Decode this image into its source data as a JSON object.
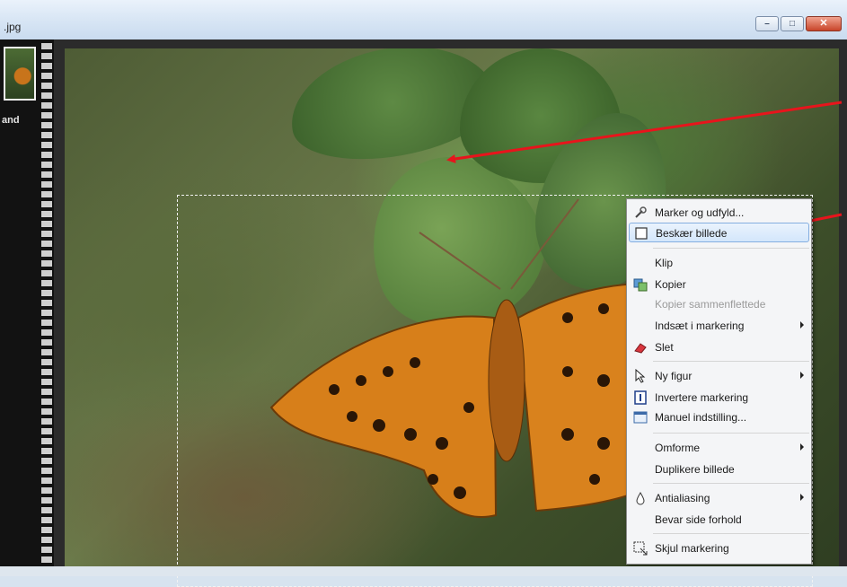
{
  "window": {
    "title": ".jpg",
    "buttons": {
      "minimize_glyph": "–",
      "maximize_glyph": "□",
      "close_glyph": "✕"
    }
  },
  "filmstrip": {
    "thumbnail_label": "and"
  },
  "context_menu": {
    "items": [
      {
        "label": "Marker og udfyld...",
        "icon": "magic-wand-icon"
      },
      {
        "label": "Beskær billede",
        "icon": "crop-icon",
        "highlighted": true
      },
      {
        "label": "Klip"
      },
      {
        "label": "Kopier",
        "icon": "copy-icon"
      },
      {
        "label": "Kopier sammenflettede",
        "disabled": true
      },
      {
        "label": "Indsæt i markering",
        "submenu": true
      },
      {
        "label": "Slet",
        "icon": "eraser-icon"
      },
      {
        "label": "Ny figur",
        "icon": "pointer-icon",
        "submenu": true
      },
      {
        "label": "Invertere markering",
        "icon": "invert-selection-icon"
      },
      {
        "label": "Manuel indstilling...",
        "icon": "window-settings-icon"
      },
      {
        "label": "Omforme",
        "submenu": true
      },
      {
        "label": "Duplikere billede"
      },
      {
        "label": "Antialiasing",
        "icon": "droplet-icon",
        "submenu": true
      },
      {
        "label": "Bevar side forhold"
      },
      {
        "label": "Skjul markering",
        "icon": "hide-selection-icon"
      }
    ]
  },
  "colors": {
    "annotation_arrow": "#e8141c",
    "butterfly": "#d77f1a",
    "highlight": "#d3e6fb"
  }
}
